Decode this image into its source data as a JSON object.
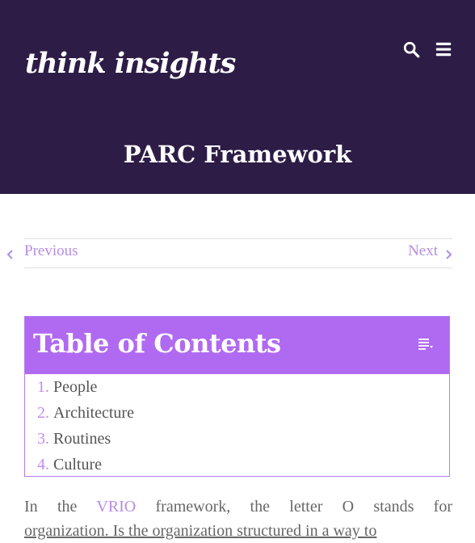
{
  "header": {
    "logo": "think insights",
    "search_icon": "search-icon",
    "menu_icon": "hamburger-menu-icon",
    "page_title": "PARC Framework",
    "bg_color": "#2d1d46"
  },
  "post_nav": {
    "previous_label": "Previous",
    "next_label": "Next",
    "link_color": "#b58de3"
  },
  "toc": {
    "title": "Table of Contents",
    "toggle_icon": "list-toggle-icon",
    "header_color": "#b06af1",
    "items": [
      {
        "num": "1.",
        "label": "People"
      },
      {
        "num": "2.",
        "label": "Architecture"
      },
      {
        "num": "3.",
        "label": "Routines"
      },
      {
        "num": "4.",
        "label": "Culture"
      }
    ]
  },
  "article": {
    "line1_pre": "In the ",
    "line1_link": "VRIO",
    "line1_post": " framework, the letter O stands for",
    "line2": "organization. Is the organization structured in a way to"
  }
}
